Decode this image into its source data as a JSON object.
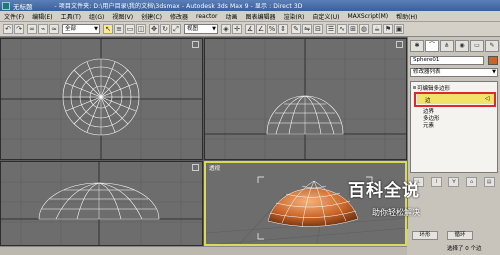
{
  "window": {
    "doc_name": "无标题",
    "title": "- 项目文件夹: D:\\用户目录\\我的文档\\3dsmax    - Autodesk 3ds Max 9    - 显示 : Direct 3D"
  },
  "menu": [
    "文件(F)",
    "编辑(E)",
    "工具(T)",
    "组(G)",
    "视图(V)",
    "创建(C)",
    "修改器",
    "reactor",
    "动画",
    "图表编辑器",
    "渲染(R)",
    "自定义(U)",
    "MAXScript(M)",
    "帮助(H)"
  ],
  "toolbar": {
    "filter_select": "全部",
    "view_select": "视图"
  },
  "viewports": {
    "top": "",
    "front": "",
    "left": "",
    "perspective": "透视"
  },
  "panel": {
    "object_name": "Sphere01",
    "modifier_list": "修改器列表",
    "stack": {
      "root": "可编辑多边形",
      "vertex": "顶点",
      "edge": "边",
      "border": "边界",
      "polygon": "多边形",
      "element": "元素"
    },
    "quad_button": "环形",
    "bevel_button": "循环",
    "selection_status": "选择了 0 个边"
  },
  "watermark": {
    "main": "百科全说",
    "sub": "助你轻松解决"
  },
  "colors": {
    "object_color": "#c86428",
    "active_viewport_border": "#d9d95a",
    "highlight_box": "#e0282c",
    "selected_edge_bg": "#f1e36a"
  }
}
